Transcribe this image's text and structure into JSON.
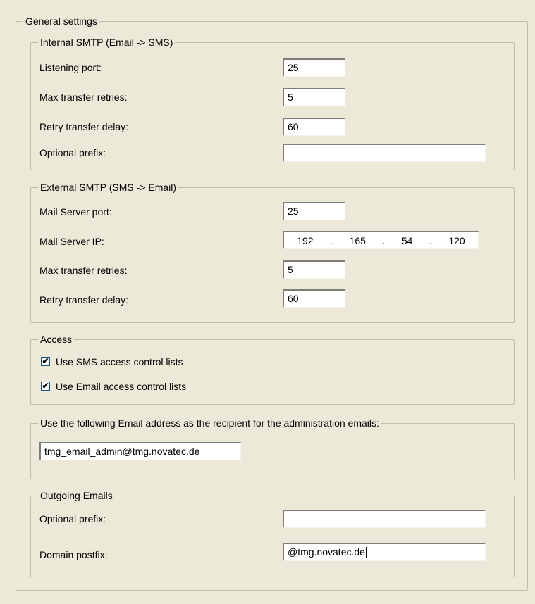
{
  "general": {
    "title": "General settings"
  },
  "internal_smtp": {
    "title": "Internal SMTP (Email -> SMS)",
    "listening_port_label": "Listening port:",
    "listening_port_value": "25",
    "max_retries_label": "Max transfer retries:",
    "max_retries_value": "5",
    "retry_delay_label": "Retry transfer delay:",
    "retry_delay_value": "60",
    "optional_prefix_label": "Optional prefix:",
    "optional_prefix_value": ""
  },
  "external_smtp": {
    "title": "External SMTP (SMS -> Email)",
    "mail_port_label": "Mail Server port:",
    "mail_port_value": "25",
    "mail_ip_label": "Mail Server IP:",
    "mail_ip": [
      "192",
      "165",
      "54",
      "120"
    ],
    "ip_separator": ".",
    "max_retries_label": "Max transfer retries:",
    "max_retries_value": "5",
    "retry_delay_label": "Retry transfer delay:",
    "retry_delay_value": "60"
  },
  "access": {
    "title": "Access",
    "sms_acl_label": "Use SMS access control lists",
    "sms_acl_checked": true,
    "email_acl_label": "Use Email access control lists",
    "email_acl_checked": true,
    "check_mark": "✔"
  },
  "admin_email": {
    "title": "Use the following Email address as the recipient for the administration emails:",
    "value": "tmg_email_admin@tmg.novatec.de"
  },
  "outgoing": {
    "title": "Outgoing Emails",
    "optional_prefix_label": "Optional prefix:",
    "optional_prefix_value": "",
    "domain_postfix_label": "Domain postfix:",
    "domain_postfix_value": "@tmg.novatec.de"
  }
}
